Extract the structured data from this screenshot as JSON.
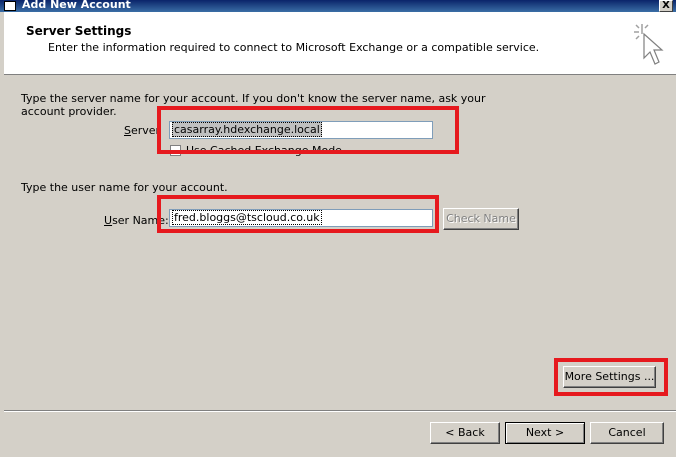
{
  "window": {
    "title": "Add New Account",
    "close_label": "X"
  },
  "header": {
    "title": "Server Settings",
    "description": "Enter the information required to connect to Microsoft Exchange or a compatible service."
  },
  "server": {
    "instructions_line1": "Type the server name for your account. If you don't know the server name, ask your",
    "instructions_line2": "account provider.",
    "label": "Server",
    "value": "casarray.hdexchange.local",
    "cached_mode_label": "Use Cached Exchange Mode"
  },
  "user": {
    "instructions": "Type the user name for your account.",
    "label": "User Name:",
    "value": "fred.bloggs@tscloud.co.uk",
    "check_name_label": "Check Name"
  },
  "buttons": {
    "more_settings": "More Settings ...",
    "back": "< Back",
    "next": "Next >",
    "cancel": "Cancel"
  },
  "colors": {
    "highlight_box": "#e6191e",
    "title_bar": "#0a246a",
    "dialog_bg": "#d4d0c8"
  }
}
